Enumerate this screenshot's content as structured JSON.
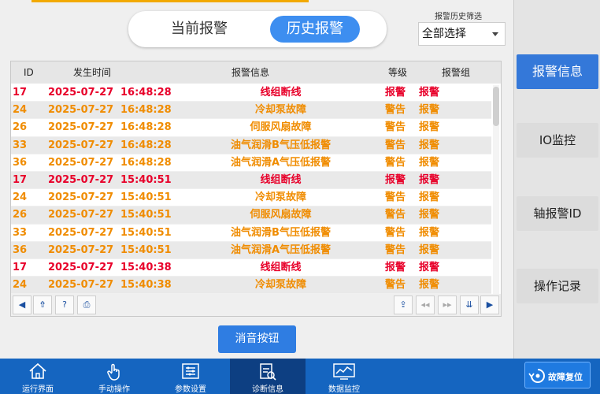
{
  "tabs": {
    "current": "当前报警",
    "history": "历史报警"
  },
  "filter": {
    "label": "报警历史筛选",
    "value": "全部选择"
  },
  "table": {
    "headers": {
      "id": "ID",
      "time": "发生时间",
      "message": "报警信息",
      "level": "等级",
      "group": "报警组"
    },
    "rows": [
      {
        "id": "17",
        "date": "2025-07-27",
        "time": "16:48:28",
        "message": "线组断线",
        "level": "报警",
        "group": "报警",
        "color": "#e8002a"
      },
      {
        "id": "24",
        "date": "2025-07-27",
        "time": "16:48:28",
        "message": "冷却泵故障",
        "level": "警告",
        "group": "报警",
        "color": "#f08c00"
      },
      {
        "id": "26",
        "date": "2025-07-27",
        "time": "16:48:28",
        "message": "伺服风扇故障",
        "level": "警告",
        "group": "报警",
        "color": "#f08c00"
      },
      {
        "id": "33",
        "date": "2025-07-27",
        "time": "16:48:28",
        "message": "油气润滑B气压低报警",
        "level": "警告",
        "group": "报警",
        "color": "#f08c00"
      },
      {
        "id": "36",
        "date": "2025-07-27",
        "time": "16:48:28",
        "message": "油气润滑A气压低报警",
        "level": "警告",
        "group": "报警",
        "color": "#f08c00"
      },
      {
        "id": "17",
        "date": "2025-07-27",
        "time": "15:40:51",
        "message": "线组断线",
        "level": "报警",
        "group": "报警",
        "color": "#e8002a"
      },
      {
        "id": "24",
        "date": "2025-07-27",
        "time": "15:40:51",
        "message": "冷却泵故障",
        "level": "警告",
        "group": "报警",
        "color": "#f08c00"
      },
      {
        "id": "26",
        "date": "2025-07-27",
        "time": "15:40:51",
        "message": "伺服风扇故障",
        "level": "警告",
        "group": "报警",
        "color": "#f08c00"
      },
      {
        "id": "33",
        "date": "2025-07-27",
        "time": "15:40:51",
        "message": "油气润滑B气压低报警",
        "level": "警告",
        "group": "报警",
        "color": "#f08c00"
      },
      {
        "id": "36",
        "date": "2025-07-27",
        "time": "15:40:51",
        "message": "油气润滑A气压低报警",
        "level": "警告",
        "group": "报警",
        "color": "#f08c00"
      },
      {
        "id": "17",
        "date": "2025-07-27",
        "time": "15:40:38",
        "message": "线组断线",
        "level": "报警",
        "group": "报警",
        "color": "#e8002a"
      },
      {
        "id": "24",
        "date": "2025-07-27",
        "time": "15:40:38",
        "message": "冷却泵故障",
        "level": "警告",
        "group": "报警",
        "color": "#f08c00"
      }
    ]
  },
  "pager_icons": [
    "prev-icon",
    "export-icon",
    "help-icon",
    "print-icon",
    "import-icon",
    "first-page-icon",
    "last-page-icon",
    "scroll-bottom-icon",
    "next-icon"
  ],
  "mute_button": "消音按钮",
  "sidebar": {
    "items": [
      "报警信息",
      "IO监控",
      "轴报警ID",
      "操作记录"
    ]
  },
  "bottom_nav": {
    "items": [
      "运行界面",
      "手动操作",
      "参数设置",
      "诊断信息",
      "数据监控"
    ],
    "reset": "故障复位"
  },
  "colors": {
    "alarm": "#e8002a",
    "warning": "#f08c00",
    "accent": "#3478d9",
    "nav": "#1565c0"
  }
}
